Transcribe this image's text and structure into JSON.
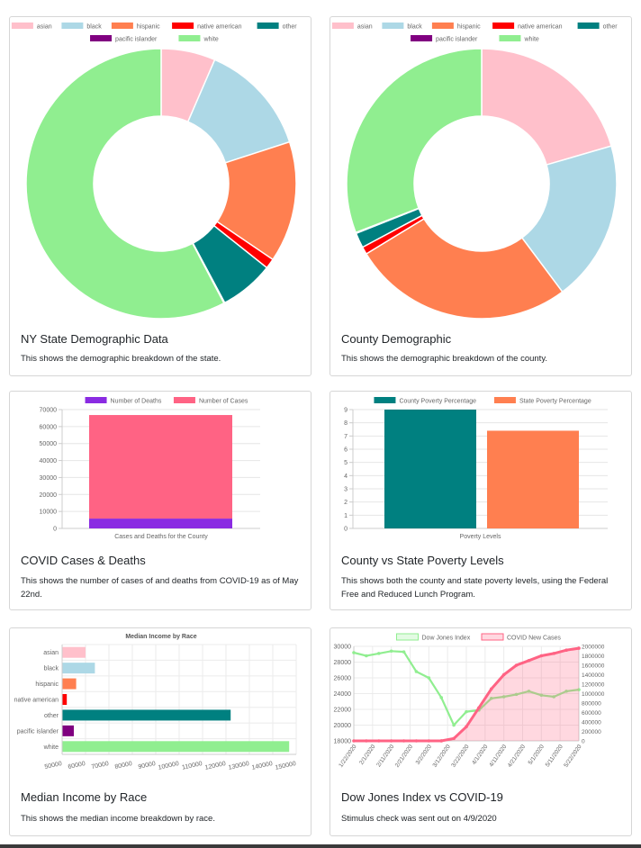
{
  "colors": {
    "asian": "#ffc0cb",
    "black": "#add8e6",
    "hispanic": "#ff7f50",
    "native american": "#ff0000",
    "other": "#008080",
    "pacific islander": "#800080",
    "white": "#90ee90"
  },
  "cards": [
    {
      "title": "NY State Demographic Data",
      "text": "This shows the demographic breakdown of the state."
    },
    {
      "title": "County Demographic",
      "text": "This shows the demographic breakdown of the county."
    },
    {
      "title": "COVID Cases & Deaths",
      "text": "This shows the number of cases of and deaths from COVID-19 as of May 22nd."
    },
    {
      "title": "County vs State Poverty Levels",
      "text": "This shows both the county and state poverty levels, using the Federal Free and Reduced Lunch Program."
    },
    {
      "title": "Median Income by Race",
      "text": "This shows the median income breakdown by race."
    },
    {
      "title": "Dow Jones Index vs COVID-19",
      "text": "Stimulus check was sent out on 4/9/2020"
    }
  ],
  "chart_data": [
    {
      "type": "pie",
      "variant": "doughnut",
      "labels": [
        "asian",
        "black",
        "hispanic",
        "native american",
        "other",
        "pacific islander",
        "white"
      ],
      "values": [
        6.5,
        13.5,
        14.5,
        1.2,
        6.5,
        0.1,
        57.7
      ],
      "legend": "top"
    },
    {
      "type": "pie",
      "variant": "doughnut",
      "labels": [
        "asian",
        "black",
        "hispanic",
        "native american",
        "other",
        "pacific islander",
        "white"
      ],
      "values": [
        20.5,
        19.3,
        26.5,
        0.9,
        1.8,
        0.1,
        30.9
      ],
      "legend": "top"
    },
    {
      "type": "bar",
      "stacked": true,
      "categories": [
        "Cases and Deaths for the County"
      ],
      "series": [
        {
          "name": "Number of Deaths",
          "values": [
            5800
          ],
          "color": "#8a2be2"
        },
        {
          "name": "Number of Cases",
          "values": [
            61000
          ],
          "color": "#ff6384"
        }
      ],
      "ylim": [
        0,
        70000
      ],
      "yticks": [
        0,
        10000,
        20000,
        30000,
        40000,
        50000,
        60000,
        70000
      ],
      "legend": "top",
      "grid": true
    },
    {
      "type": "bar",
      "categories": [
        "Poverty Levels"
      ],
      "series": [
        {
          "name": "County Poverty Percentage",
          "values": [
            9
          ],
          "color": "#008080"
        },
        {
          "name": "State Poverty Percentage",
          "values": [
            7.4
          ],
          "color": "#ff7f50"
        }
      ],
      "ylim": [
        0,
        9
      ],
      "yticks": [
        0,
        1,
        2,
        3,
        4,
        5,
        6,
        7,
        8,
        9
      ],
      "legend": "top",
      "grid": true
    },
    {
      "type": "bar",
      "orientation": "horizontal",
      "title": "Median Income by Race",
      "categories": [
        "asian",
        "black",
        "hispanic",
        "native american",
        "other",
        "pacific islander",
        "white"
      ],
      "values": [
        60000,
        64000,
        56000,
        52000,
        122000,
        55000,
        147000
      ],
      "xlim": [
        50000,
        150000
      ],
      "xticks": [
        50000,
        60000,
        70000,
        80000,
        90000,
        100000,
        110000,
        120000,
        130000,
        140000,
        150000
      ],
      "grid": true
    },
    {
      "type": "line",
      "x": [
        "1/22/2020",
        "1/29/2020",
        "2/5/2020",
        "2/12/2020",
        "2/19/2020",
        "2/26/2020",
        "3/4/2020",
        "3/11/2020",
        "3/18/2020",
        "3/25/2020",
        "4/1/2020",
        "4/8/2020",
        "4/15/2020",
        "4/22/2020",
        "4/29/2020",
        "5/6/2020",
        "5/13/2020",
        "5/20/2020",
        "5/22/2020"
      ],
      "xticks": [
        "1/22/2020",
        "2/1/2020",
        "2/11/2020",
        "2/21/2020",
        "3/2/2020",
        "3/12/2020",
        "3/22/2020",
        "4/1/2020",
        "4/11/2020",
        "4/21/2020",
        "5/1/2020",
        "5/11/2020",
        "5/22/2020"
      ],
      "series": [
        {
          "name": "Dow Jones Index",
          "axis": "left",
          "color": "#90ee90",
          "fill": false,
          "values": [
            29200,
            28800,
            29100,
            29400,
            29300,
            26800,
            26000,
            23500,
            20000,
            21700,
            21900,
            23400,
            23600,
            23900,
            24300,
            23800,
            23600,
            24300,
            24500
          ]
        },
        {
          "name": "COVID New Cases",
          "axis": "right",
          "color": "#ff6384",
          "fill": true,
          "values": [
            0,
            0,
            0,
            0,
            0,
            0,
            0,
            500,
            50000,
            300000,
            700000,
            1100000,
            1400000,
            1600000,
            1700000,
            1800000,
            1850000,
            1920000,
            1960000
          ]
        }
      ],
      "ylim_left": [
        18000,
        30000
      ],
      "yticks_left": [
        18000,
        20000,
        22000,
        24000,
        26000,
        28000,
        30000
      ],
      "ylim_right": [
        0,
        2000000
      ],
      "yticks_right": [
        0,
        200000,
        400000,
        600000,
        800000,
        1000000,
        1200000,
        1400000,
        1600000,
        1800000,
        2000000
      ],
      "legend": "top",
      "grid": true
    }
  ]
}
